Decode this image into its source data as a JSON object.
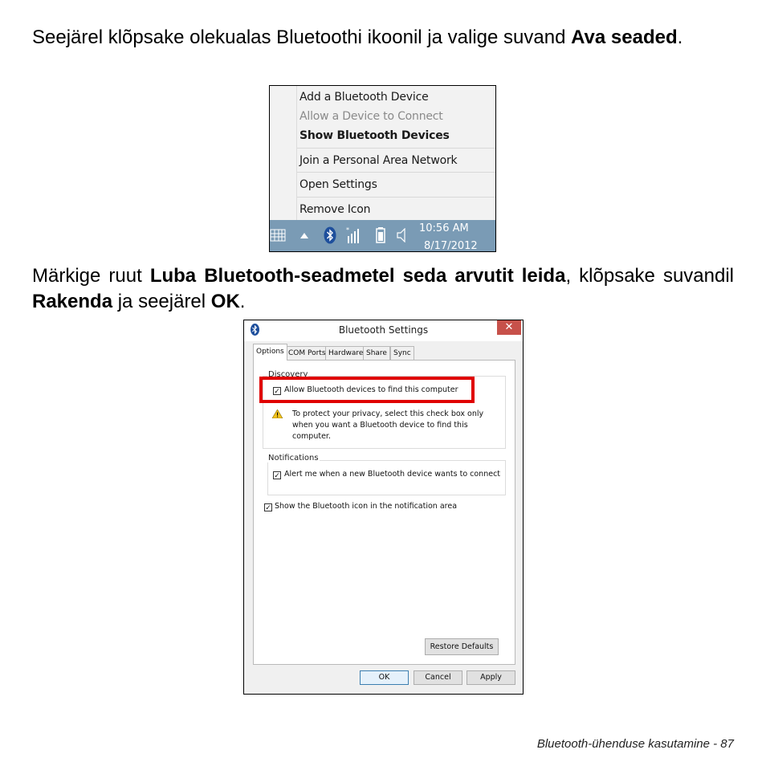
{
  "intro": {
    "text_before": "Seejärel klõpsake olekualas Bluetoothi ikoonil ja valige suvand ",
    "bold_text": "Ava seaded",
    "text_after": "."
  },
  "context_menu": {
    "items": [
      {
        "label": "Add a Bluetooth Device",
        "state": "normal"
      },
      {
        "label": "Allow a Device to Connect",
        "state": "disabled"
      },
      {
        "label": "Show Bluetooth Devices",
        "state": "bold"
      },
      {
        "label": "Join a Personal Area Network",
        "state": "normal"
      },
      {
        "label": "Open Settings",
        "state": "normal"
      },
      {
        "label": "Remove Icon",
        "state": "normal"
      }
    ]
  },
  "taskbar": {
    "time": "10:56 AM",
    "date": "8/17/2012",
    "icons": [
      "keyboard-icon",
      "chevron-up-icon",
      "bluetooth-icon",
      "network-icon",
      "battery-icon",
      "speaker-icon"
    ],
    "background_color": "#7a9bb5"
  },
  "instruction": {
    "part1": "Märkige ruut ",
    "bold1": "Luba Bluetooth-seadmetel seda arvutit leida",
    "part2": ", klõpsake suvandil ",
    "bold2": "Rakenda",
    "part3": " ja seejärel ",
    "bold3": "OK",
    "part4": "."
  },
  "dialog": {
    "title": "Bluetooth Settings",
    "close_glyph": "✕",
    "tabs": [
      "Options",
      "COM Ports",
      "Hardware",
      "Share",
      "Sync"
    ],
    "active_tab": "Options",
    "discovery": {
      "group_label": "Discovery",
      "allow_checkbox": {
        "label": "Allow Bluetooth devices to find this computer",
        "checked": true
      },
      "warning": "To protect your privacy, select this check box only when you want a Bluetooth device to find this computer."
    },
    "notifications": {
      "group_label": "Notifications",
      "alert_checkbox": {
        "label": "Alert me when a new Bluetooth device wants to connect",
        "checked": true
      }
    },
    "show_icon_checkbox": {
      "label": "Show the Bluetooth icon in the notification area",
      "checked": true
    },
    "restore_defaults": "Restore Defaults",
    "ok": "OK",
    "cancel": "Cancel",
    "apply": "Apply",
    "highlight_color": "#e00000",
    "close_button_color": "#c7514a"
  },
  "footer": {
    "text": "Bluetooth-ühenduse kasutamine -  87"
  }
}
